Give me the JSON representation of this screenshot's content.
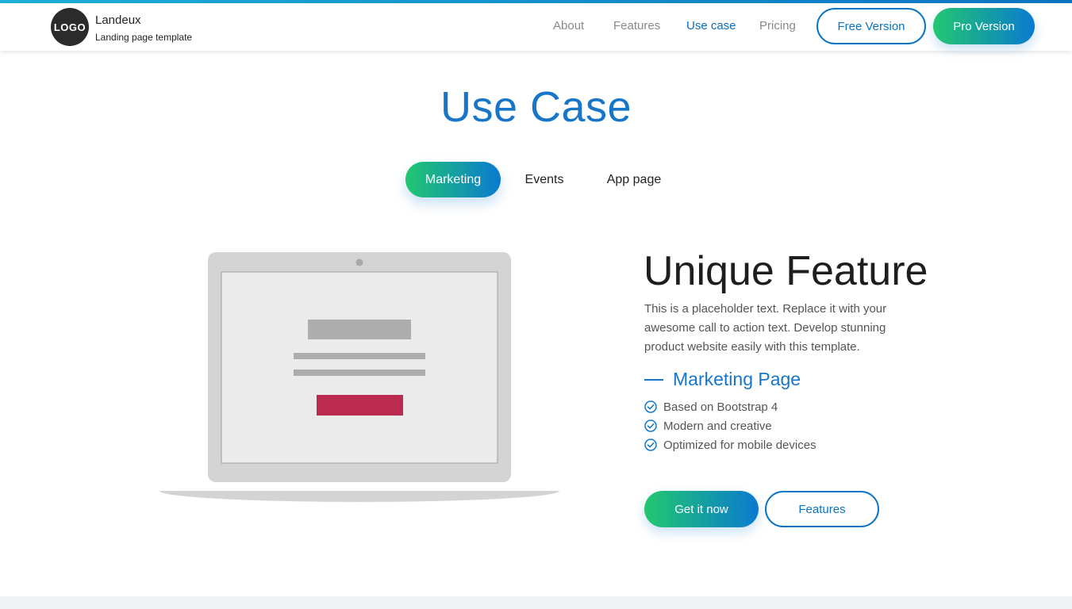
{
  "brand": {
    "logo_text": "LOGO",
    "name": "Landeux",
    "tagline": "Landing page template"
  },
  "nav": {
    "links": [
      {
        "label": "About"
      },
      {
        "label": "Features"
      },
      {
        "label": "Use case",
        "active": true
      },
      {
        "label": "Pricing"
      }
    ],
    "free_button": "Free Version",
    "pro_button": "Pro Version"
  },
  "section": {
    "title": "Use Case",
    "tabs": [
      {
        "label": "Marketing",
        "active": true
      },
      {
        "label": "Events"
      },
      {
        "label": "App page"
      }
    ]
  },
  "feature": {
    "title": "Unique Feature",
    "text": "This is a placeholder text. Replace it with your awesome call to action text. Develop stunning product website easily with this template.",
    "subheading": "Marketing Page",
    "bullets": [
      "Based on Bootstrap 4",
      "Modern and creative",
      "Optimized for mobile devices"
    ],
    "cta_primary": "Get it now",
    "cta_secondary": "Features"
  },
  "colors": {
    "accent_blue": "#1776c8",
    "gradient_start": "#22c76f",
    "gradient_end": "#0a7ad0",
    "laptop_cta_red": "#bb2a4f"
  },
  "icons": {
    "check": "check-circle-icon"
  }
}
